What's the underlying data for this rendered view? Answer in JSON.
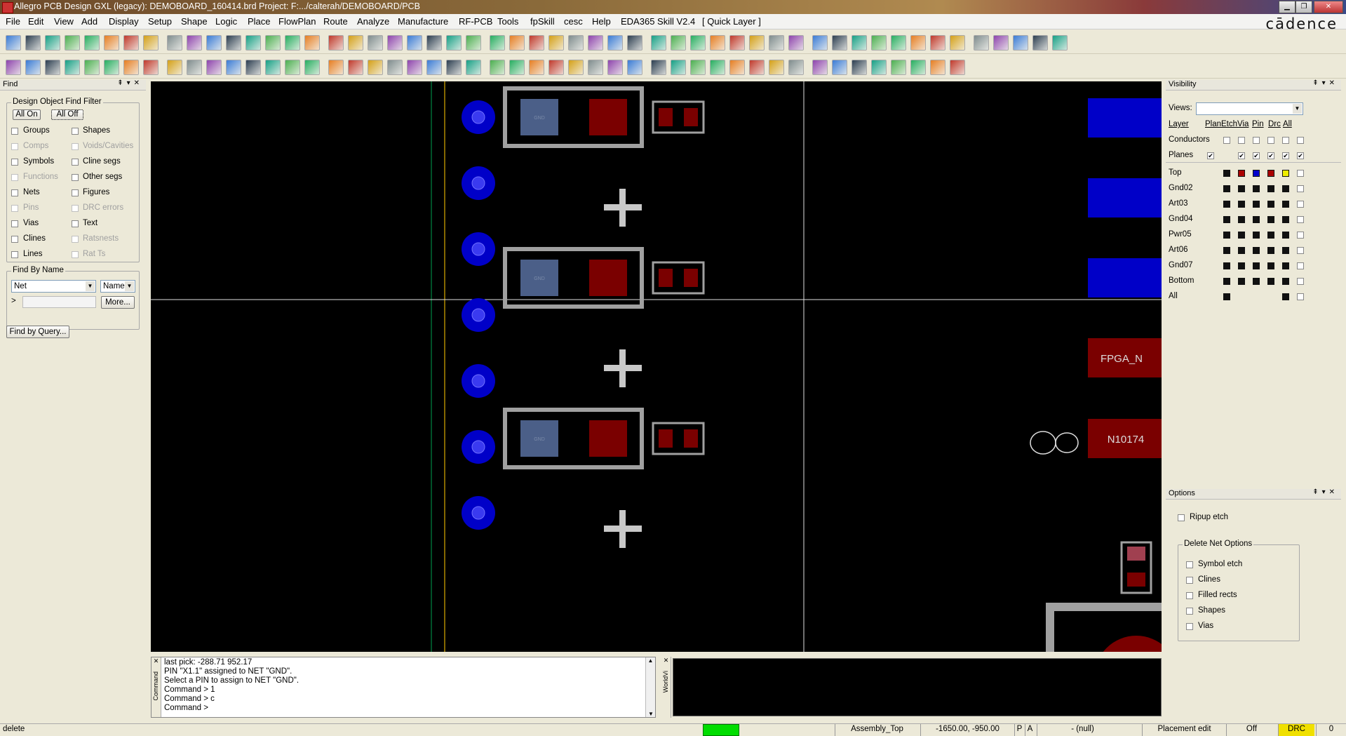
{
  "app": {
    "title": "Allegro PCB Design GXL (legacy): DEMOBOARD_160414.brd  Project: F:.../calterah/DEMOBOARD/PCB",
    "brand": "cādence"
  },
  "menu": [
    "File",
    "Edit",
    "View",
    "Add",
    "Display",
    "Setup",
    "Shape",
    "Logic",
    "Place",
    "FlowPlan",
    "Route",
    "Analyze",
    "Manufacture",
    "RF-PCB",
    "Tools",
    "fpSkill",
    "cesc",
    "Help",
    "EDA365 Skill V2.4",
    "[ Quick Layer ]"
  ],
  "find_panel": {
    "title": "Find",
    "filter_group": "Design Object Find Filter",
    "all_on": "All On",
    "all_off": "All Off",
    "left_items": [
      {
        "label": "Groups",
        "enabled": true
      },
      {
        "label": "Comps",
        "enabled": false
      },
      {
        "label": "Symbols",
        "enabled": true
      },
      {
        "label": "Functions",
        "enabled": false
      },
      {
        "label": "Nets",
        "enabled": true
      },
      {
        "label": "Pins",
        "enabled": false
      },
      {
        "label": "Vias",
        "enabled": true
      },
      {
        "label": "Clines",
        "enabled": true
      },
      {
        "label": "Lines",
        "enabled": true
      }
    ],
    "right_items": [
      {
        "label": "Shapes",
        "enabled": true
      },
      {
        "label": "Voids/Cavities",
        "enabled": false
      },
      {
        "label": "Cline segs",
        "enabled": true
      },
      {
        "label": "Other segs",
        "enabled": true
      },
      {
        "label": "Figures",
        "enabled": true
      },
      {
        "label": "DRC errors",
        "enabled": false
      },
      {
        "label": "Text",
        "enabled": true
      },
      {
        "label": "Ratsnests",
        "enabled": false
      },
      {
        "label": "Rat Ts",
        "enabled": false
      }
    ],
    "find_by_name_group": "Find By Name",
    "type_value": "Net",
    "mode_value": "Name",
    "prompt": ">",
    "name_value": "",
    "more": "More...",
    "find_by_query": "Find by Query..."
  },
  "visibility_panel": {
    "title": "Visibility",
    "views_label": "Views:",
    "views_value": "",
    "columns": [
      "Layer",
      "Plan",
      "Etch",
      "Via",
      "Pin",
      "Drc",
      "All"
    ],
    "conductors": "Conductors",
    "planes": "Planes",
    "layers": [
      "Top",
      "Gnd02",
      "Art03",
      "Gnd04",
      "Pwr05",
      "Art06",
      "Gnd07",
      "Bottom",
      "All"
    ]
  },
  "options_panel": {
    "title": "Options",
    "ripup_etch": "Ripup etch",
    "group": "Delete Net Options",
    "items": [
      "Symbol etch",
      "Clines",
      "Filled rects",
      "Shapes",
      "Vias"
    ]
  },
  "canvas": {
    "pad_label": "GND",
    "net_label_1": "FPGA_N",
    "net_label_2": "N10174"
  },
  "console": {
    "side_label": "Command",
    "lines": [
      "last pick:  -288.71 952.17",
      "PIN \"X1.1\" assigned to NET \"GND\".",
      "Select a PIN to assign to NET \"GND\".",
      "Command > 1",
      "Command > c",
      "Command >"
    ]
  },
  "worldview_label": "WorldVi",
  "status": {
    "command": "delete",
    "subclass": "Assembly_Top",
    "coords": "-1650.00, -950.00",
    "p": "P",
    "a": "A",
    "null": "- (null)",
    "mode": "Placement edit",
    "off": "Off",
    "drc": "DRC",
    "count": "0"
  },
  "colors": {
    "canvas": "#000000",
    "via": "#0000c8",
    "pad_red": "#7a0000",
    "pad_blue": "#4b5f88",
    "outline": "#a0a0a0",
    "drc_yellow": "#f0e000",
    "status_green": "#00dd00"
  }
}
